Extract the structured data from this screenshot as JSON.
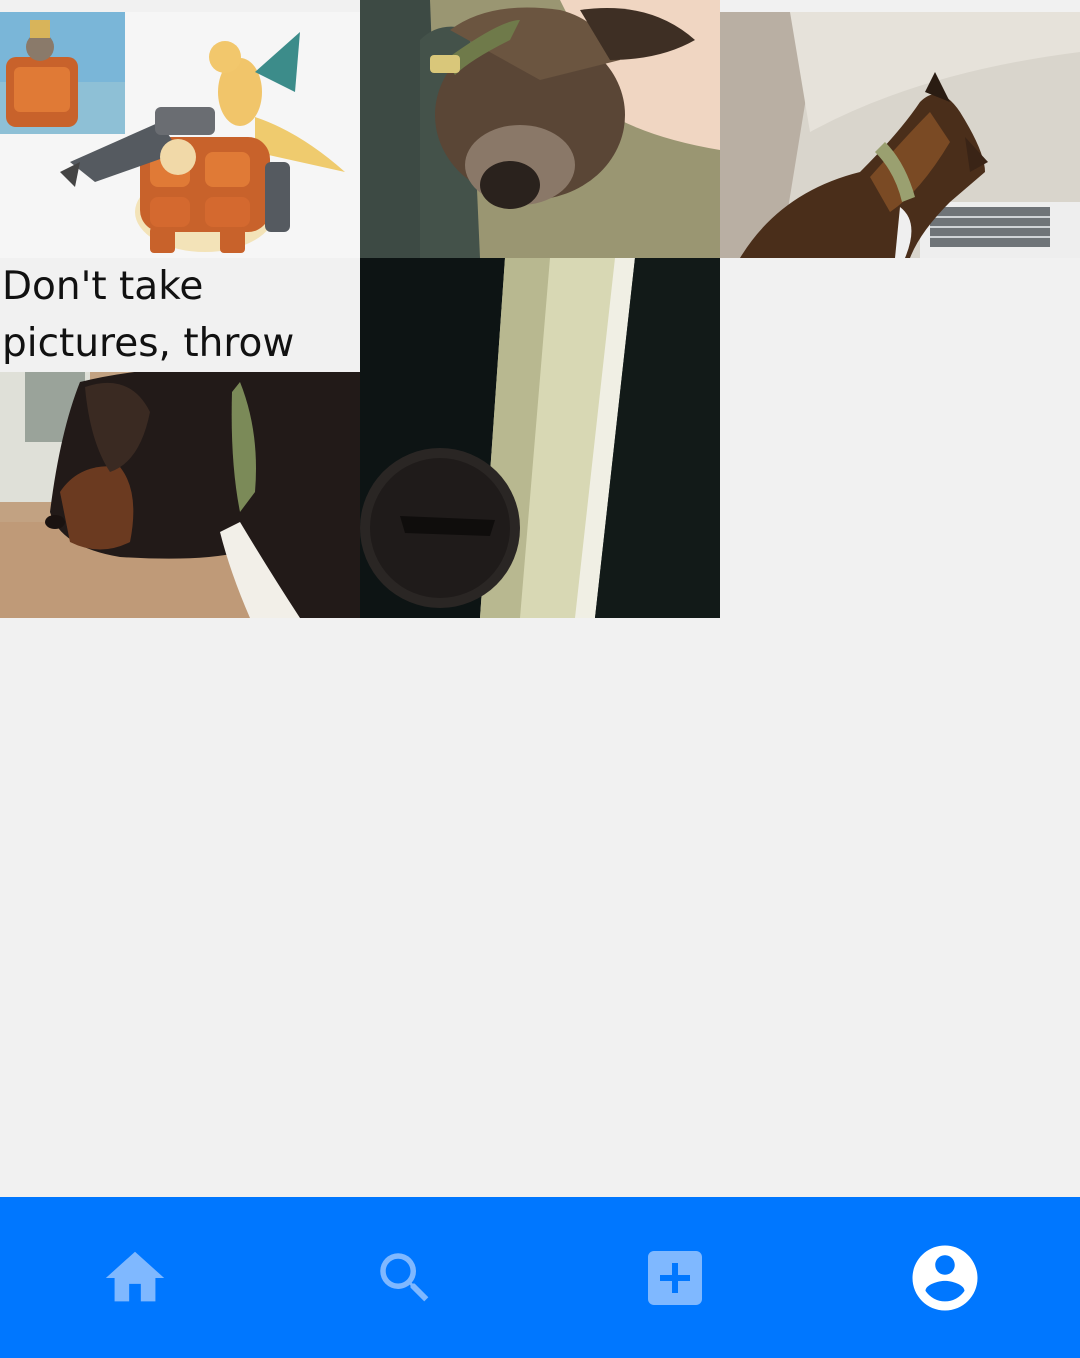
{
  "posts": [
    {
      "id": "pokemon-art",
      "caption": ""
    },
    {
      "id": "sleeping-dog",
      "caption": ""
    },
    {
      "id": "dog-in-van",
      "caption": ""
    },
    {
      "id": "dog-profile",
      "caption": "Don't take pictures, throw the ball!"
    },
    {
      "id": "door-lock",
      "caption": ""
    }
  ],
  "nav": {
    "items": [
      {
        "name": "home",
        "icon": "home-icon",
        "active": false
      },
      {
        "name": "search",
        "icon": "search-icon",
        "active": false
      },
      {
        "name": "add",
        "icon": "add-box-icon",
        "active": false
      },
      {
        "name": "profile",
        "icon": "account-circle-icon",
        "active": true
      }
    ]
  },
  "colors": {
    "nav_bg": "#0077ff",
    "nav_icon_inactive": "#7fb8ff",
    "nav_icon_active": "#ffffff",
    "page_bg": "#f1f1f1"
  }
}
